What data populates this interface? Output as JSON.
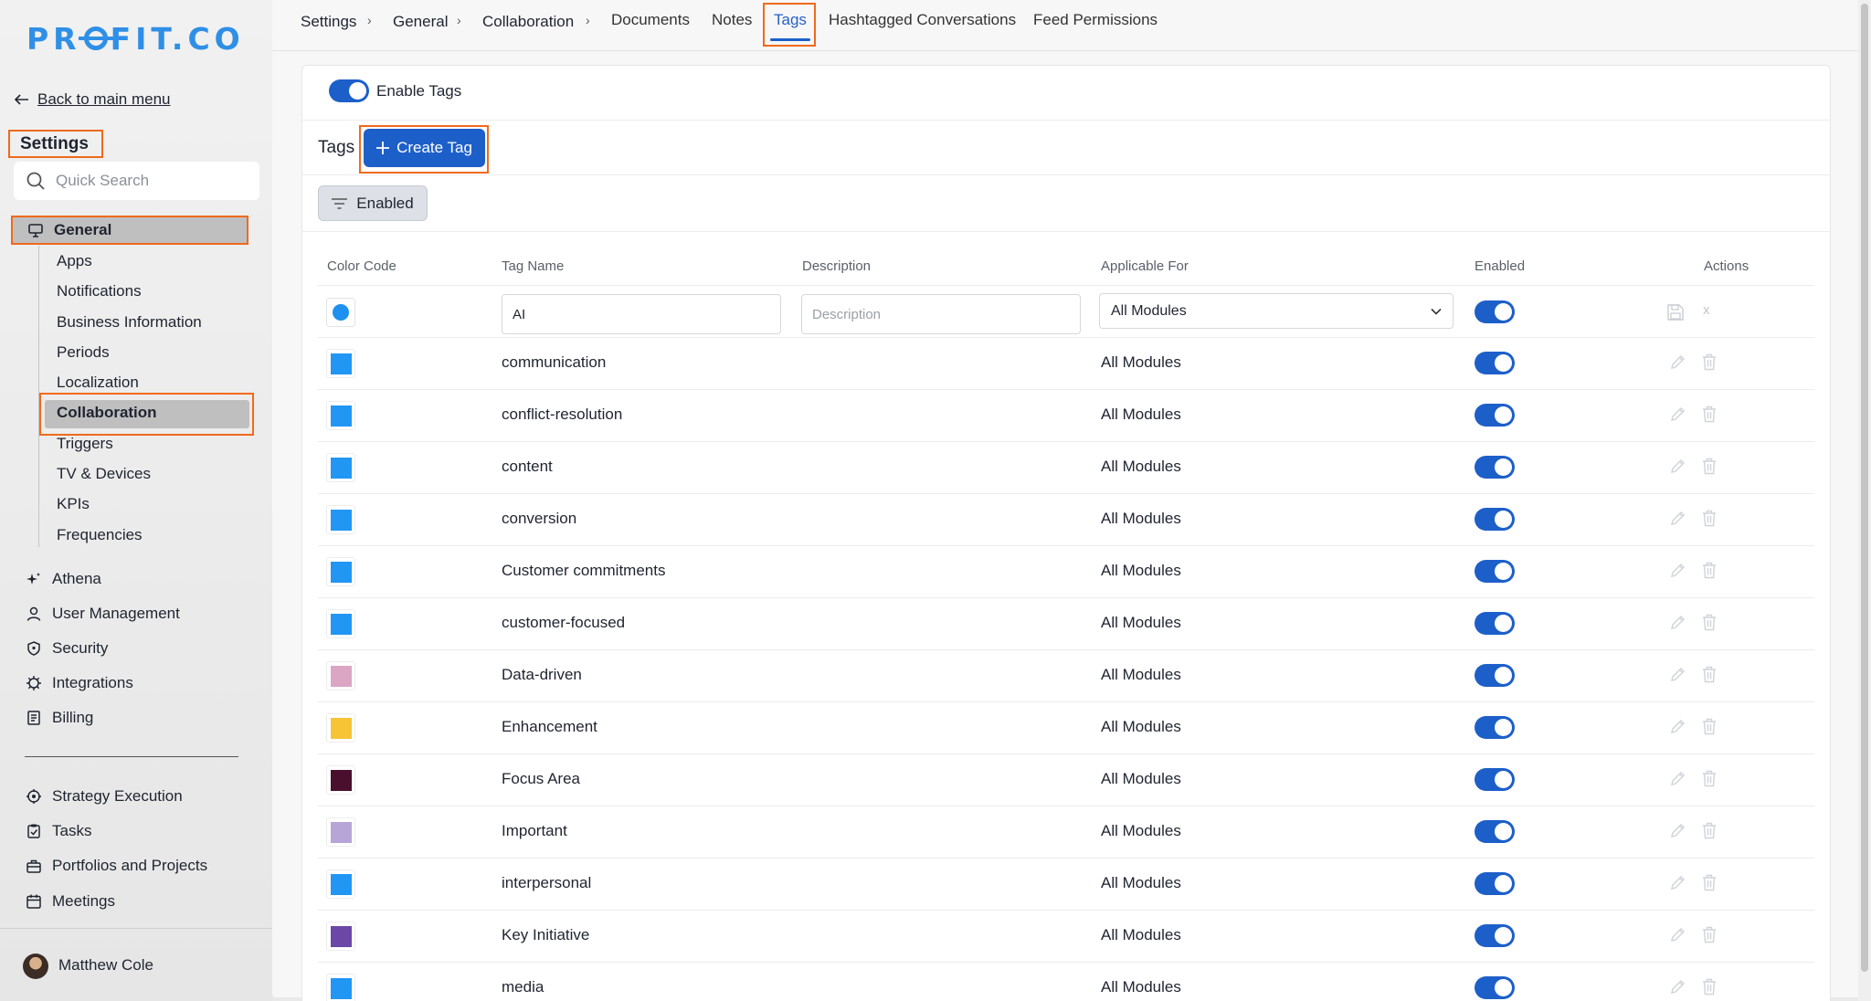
{
  "sidebar": {
    "logo": "PROFIT.CO",
    "back_link": "Back to main menu",
    "title": "Settings",
    "search_placeholder": "Quick Search",
    "general_label": "General",
    "general_subitems": [
      "Apps",
      "Notifications",
      "Business Information",
      "Periods",
      "Localization",
      "Collaboration",
      "Triggers",
      "TV & Devices",
      "KPIs",
      "Frequencies"
    ],
    "items": [
      {
        "label": "Athena",
        "icon": "sparkle-icon"
      },
      {
        "label": "User Management",
        "icon": "user-icon"
      },
      {
        "label": "Security",
        "icon": "shield-icon"
      },
      {
        "label": "Integrations",
        "icon": "chip-icon"
      },
      {
        "label": "Billing",
        "icon": "receipt-icon"
      }
    ],
    "items2": [
      {
        "label": "Strategy Execution",
        "icon": "target-icon"
      },
      {
        "label": "Tasks",
        "icon": "clipboard-check-icon"
      },
      {
        "label": "Portfolios and Projects",
        "icon": "briefcase-icon"
      },
      {
        "label": "Meetings",
        "icon": "calendar-icon"
      }
    ],
    "user_name": "Matthew Cole"
  },
  "breadcrumb": [
    "Settings",
    "General",
    "Collaboration"
  ],
  "tabs": [
    "Documents",
    "Notes",
    "Tags",
    "Hashtagged Conversations",
    "Feed Permissions"
  ],
  "active_tab": "Tags",
  "panel": {
    "enable_label": "Enable Tags",
    "tags_label": "Tags",
    "create_button": "Create Tag",
    "filter_button": "Enabled",
    "columns": [
      "Color Code",
      "Tag Name",
      "Description",
      "Applicable For",
      "Enabled",
      "Actions"
    ],
    "new_row": {
      "tag_name_value": "AI",
      "description_placeholder": "Description",
      "applicable": "All Modules",
      "color": "#1e90ef",
      "enabled": true,
      "cancel_glyph": "x"
    },
    "rows": [
      {
        "name": "communication",
        "color": "#2196f3",
        "applicable": "All Modules",
        "enabled": true
      },
      {
        "name": "conflict-resolution",
        "color": "#2196f3",
        "applicable": "All Modules",
        "enabled": true
      },
      {
        "name": "content",
        "color": "#2196f3",
        "applicable": "All Modules",
        "enabled": true
      },
      {
        "name": "conversion",
        "color": "#2196f3",
        "applicable": "All Modules",
        "enabled": true
      },
      {
        "name": "Customer commitments",
        "color": "#2196f3",
        "applicable": "All Modules",
        "enabled": true
      },
      {
        "name": "customer-focused",
        "color": "#2196f3",
        "applicable": "All Modules",
        "enabled": true
      },
      {
        "name": "Data-driven",
        "color": "#dba6c4",
        "applicable": "All Modules",
        "enabled": true
      },
      {
        "name": "Enhancement",
        "color": "#f6c436",
        "applicable": "All Modules",
        "enabled": true
      },
      {
        "name": "Focus Area",
        "color": "#4b0f2e",
        "applicable": "All Modules",
        "enabled": true
      },
      {
        "name": "Important",
        "color": "#b7a5d8",
        "applicable": "All Modules",
        "enabled": true
      },
      {
        "name": "interpersonal",
        "color": "#2196f3",
        "applicable": "All Modules",
        "enabled": true
      },
      {
        "name": "Key Initiative",
        "color": "#6b47a8",
        "applicable": "All Modules",
        "enabled": true
      },
      {
        "name": "media",
        "color": "#2196f3",
        "applicable": "All Modules",
        "enabled": true
      }
    ]
  },
  "colors": {
    "accent": "#1d5fc9",
    "highlight": "#f06a1c"
  }
}
